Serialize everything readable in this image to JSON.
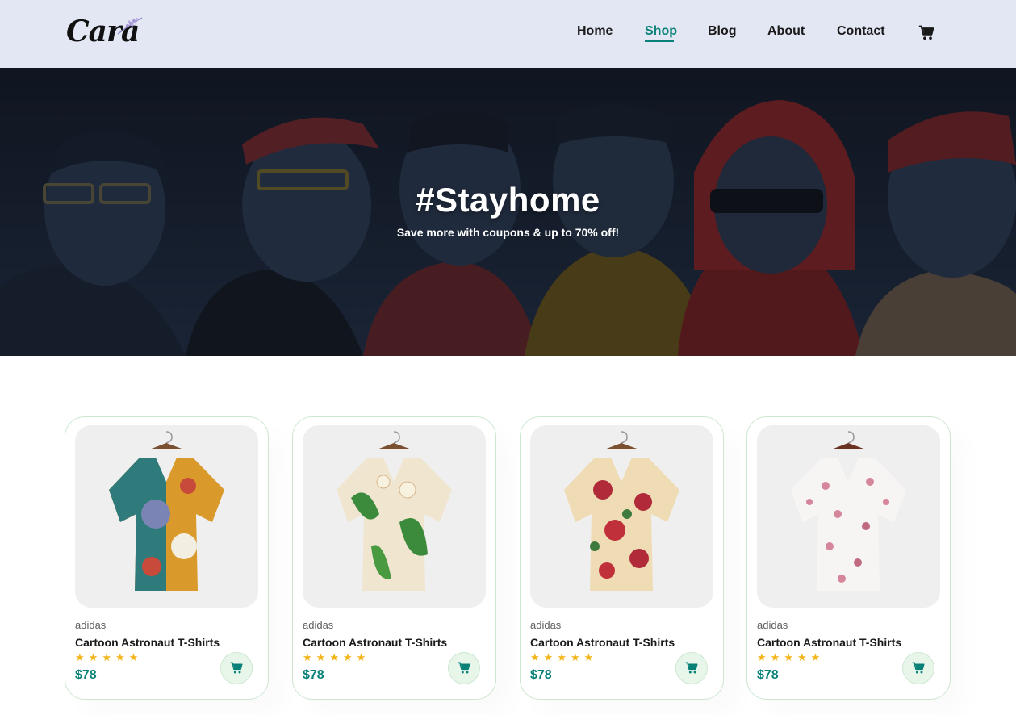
{
  "header": {
    "logo_text": "Cara",
    "nav": [
      {
        "label": "Home",
        "active": false
      },
      {
        "label": "Shop",
        "active": true
      },
      {
        "label": "Blog",
        "active": false
      },
      {
        "label": "About",
        "active": false
      },
      {
        "label": "Contact",
        "active": false
      }
    ],
    "cart_icon": "shopping-cart-icon"
  },
  "hero": {
    "title": "#Stayhome",
    "subtitle": "Save more with coupons & up to 70% off!"
  },
  "products": [
    {
      "brand": "adidas",
      "name": "Cartoon Astronaut T-Shirts",
      "rating": 5,
      "price": "$78",
      "image": "shirt-abstract-orange-teal"
    },
    {
      "brand": "adidas",
      "name": "Cartoon Astronaut T-Shirts",
      "rating": 5,
      "price": "$78",
      "image": "shirt-green-leaf-floral"
    },
    {
      "brand": "adidas",
      "name": "Cartoon Astronaut T-Shirts",
      "rating": 5,
      "price": "$78",
      "image": "shirt-red-rose-floral"
    },
    {
      "brand": "adidas",
      "name": "Cartoon Astronaut T-Shirts",
      "rating": 5,
      "price": "$78",
      "image": "shirt-white-pink-blossom"
    }
  ],
  "colors": {
    "accent": "#088178",
    "header_bg": "#e3e6f3",
    "star": "#f3b519",
    "card_border": "#cce7d0"
  }
}
